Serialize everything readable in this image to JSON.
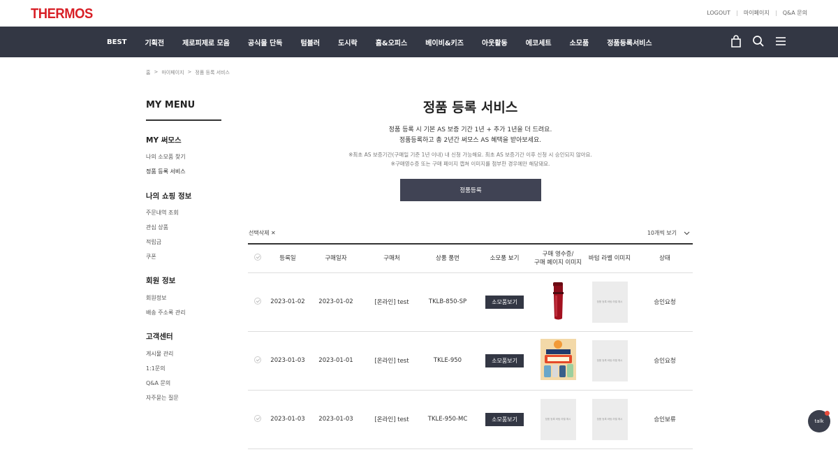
{
  "brand": {
    "logo": "THERMOS"
  },
  "util_links": [
    "LOGOUT",
    "마이페이지",
    "Q&A 문의"
  ],
  "gnb": [
    "BEST",
    "기획전",
    "제로피제로 모음",
    "공식몰 단독",
    "텀블러",
    "도시락",
    "홈&오피스",
    "베이비&키즈",
    "아웃활동",
    "에코세트",
    "소모품",
    "정품등록서비스"
  ],
  "gnb_icons": [
    "shopping-bag-icon",
    "search-icon",
    "menu-icon"
  ],
  "breadcrumb": [
    "홈",
    ">",
    "마이페이지",
    ">",
    "정품 등록 서비스"
  ],
  "sidebar": {
    "title": "MY MENU",
    "groups": [
      {
        "label": "MY 써모스",
        "items": [
          "나의 소모품 찾기",
          "정품 등록 서비스"
        ]
      },
      {
        "label": "나의 쇼핑 정보",
        "items": [
          "주문내역 조회",
          "관심 상품",
          "적립금",
          "쿠폰"
        ]
      },
      {
        "label": "회원 정보",
        "items": [
          "회원정보",
          "배송 주소록 관리"
        ]
      },
      {
        "label": "고객센터",
        "items": [
          "게시물 관리",
          "1:1문의",
          "Q&A 문의",
          "자주묻는 질문"
        ]
      }
    ]
  },
  "main": {
    "title": "정품 등록 서비스",
    "desc1": "정품 등록 시 기본 AS 보증 기간 1년 + 추가 1년을 더 드려요.",
    "desc2": "정품등록하고 총 2년간 써모스 AS 혜택을 받아보세요.",
    "note1": "※최초 AS 보증기간(구매일 기준 1년 이내) 내 신청 가능해요. 최초 AS 보증기간 이후 신청 시 승인되지 않아요.",
    "note2": "※구매영수증 또는 구매 페이지 캡쳐 이미지를 첨부한 경우에만 해당돼요.",
    "register_button": "정품등록",
    "delete_selected": "선택삭제 ✕",
    "page_size": "10개씩 보기"
  },
  "table": {
    "headers": [
      "",
      "등록일",
      "구매일자",
      "구매처",
      "상품 품번",
      "소모품 보기",
      "구매 영수증/\n구매 페이지 이미지",
      "바텀 라벨 이미지",
      "상태"
    ],
    "shop_button": "소모품보기",
    "placeholder": "정품 등록 바텀 라벨 예시",
    "rows": [
      {
        "reg": "2023-01-02",
        "buy": "2023-01-02",
        "store": "[온라인] test",
        "code": "TKLB-850-SP",
        "receipt": "product",
        "status": "승인요청"
      },
      {
        "reg": "2023-01-03",
        "buy": "2023-01-01",
        "store": "[온라인] test",
        "code": "TKLE-950",
        "receipt": "poster",
        "status": "승인요청"
      },
      {
        "reg": "2023-01-03",
        "buy": "2023-01-03",
        "store": "[온라인] test",
        "code": "TKLE-950-MC",
        "receipt": "placeholder",
        "status": "승인보류"
      }
    ]
  },
  "talk": "talk",
  "colors": {
    "brand_red": "#d81f26",
    "nav_dark": "#333744",
    "button_dark": "#404354"
  }
}
